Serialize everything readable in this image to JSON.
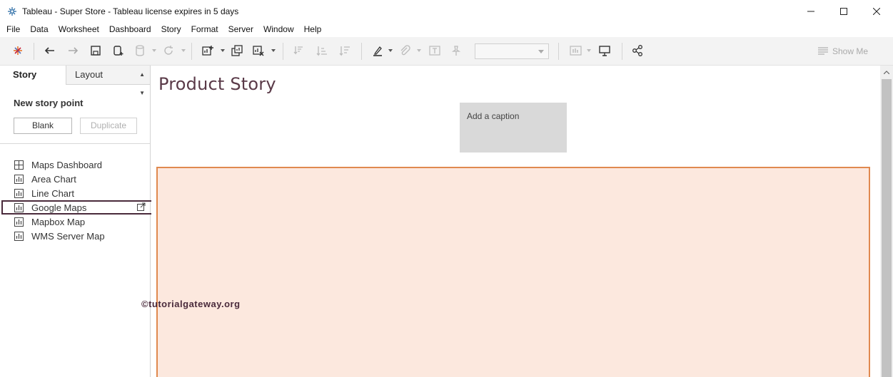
{
  "window": {
    "title": "Tableau - Super Store - Tableau license expires in 5 days",
    "minimize_label": "—",
    "maximize_label": "☐",
    "close_label": "✕"
  },
  "menu": [
    "File",
    "Data",
    "Worksheet",
    "Dashboard",
    "Story",
    "Format",
    "Server",
    "Window",
    "Help"
  ],
  "toolbar": {
    "show_me_label": "Show Me",
    "icons": [
      "tableau-logo-icon",
      "undo-icon",
      "redo-icon",
      "save-icon",
      "new-data-source-icon",
      "pause-updates-icon",
      "refresh-icon",
      "new-worksheet-icon",
      "duplicate-sheet-icon",
      "clear-sheet-icon",
      "swap-icon",
      "sort-ascending-icon",
      "sort-descending-icon",
      "highlight-icon",
      "group-icon",
      "labels-icon",
      "pin-icon",
      "fit-dropdown",
      "show-cards-icon",
      "presentation-icon",
      "share-icon"
    ]
  },
  "left_panel": {
    "tabs": [
      "Story",
      "Layout"
    ],
    "new_story_point_label": "New story point",
    "blank_button": "Blank",
    "duplicate_button": "Duplicate",
    "sheets": [
      {
        "label": "Maps Dashboard",
        "icon": "dashboard-icon"
      },
      {
        "label": "Area Chart",
        "icon": "worksheet-icon"
      },
      {
        "label": "Line Chart",
        "icon": "worksheet-icon"
      },
      {
        "label": "Google Maps",
        "icon": "worksheet-icon",
        "selected": true
      },
      {
        "label": "Mapbox Map",
        "icon": "worksheet-icon"
      },
      {
        "label": "WMS Server Map",
        "icon": "worksheet-icon"
      }
    ]
  },
  "story": {
    "title": "Product Story",
    "caption_placeholder": "Add a caption"
  },
  "watermark": "©tutorialgateway.org",
  "colors": {
    "story_frame_fill": "#fce8de",
    "story_frame_border": "#e0894f",
    "title_color": "#5a3a48",
    "selection_border": "#4a2a3b"
  }
}
